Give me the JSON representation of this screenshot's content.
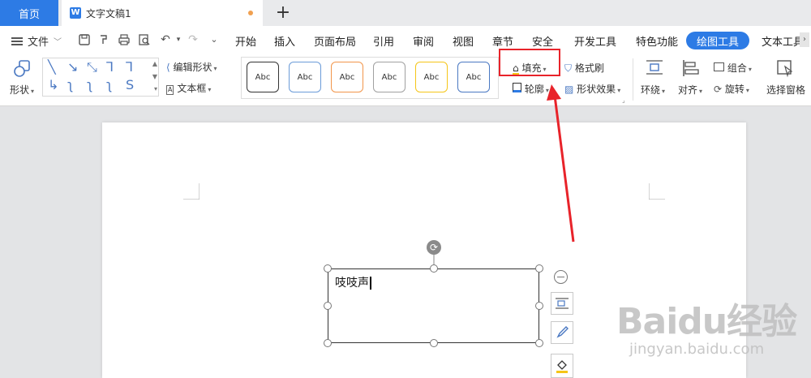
{
  "tabs": {
    "home": "首页",
    "doc": "文字文稿1",
    "doc_badge": "W",
    "new_tab": "+"
  },
  "menubar": {
    "file": "文件",
    "items": [
      "开始",
      "插入",
      "页面布局",
      "引用",
      "审阅",
      "视图",
      "章节",
      "安全",
      "开发工具",
      "特色功能",
      "绘图工具",
      "文本工具"
    ],
    "active": "绘图工具"
  },
  "ribbon": {
    "shape": "形状",
    "edit_shape": "编辑形状",
    "text_frame": "文本框",
    "style_label": "Abc",
    "style_colors": [
      "#333333",
      "#6b9bd8",
      "#f2954a",
      "#a0a0a0",
      "#f5c518",
      "#4a78c2"
    ],
    "fill": "填充",
    "format_painter": "格式刷",
    "outline": "轮廓",
    "shape_effects": "形状效果",
    "wrap": "环绕",
    "align": "对齐",
    "group": "组合",
    "rotate": "旋转",
    "selection_pane": "选择窗格"
  },
  "document": {
    "textbox_text": "吱吱声"
  },
  "accent": "#2d7be5",
  "highlight_color": "#e8232a",
  "watermark": {
    "main": "Baidu经验",
    "sub": "jingyan.baidu.com"
  }
}
